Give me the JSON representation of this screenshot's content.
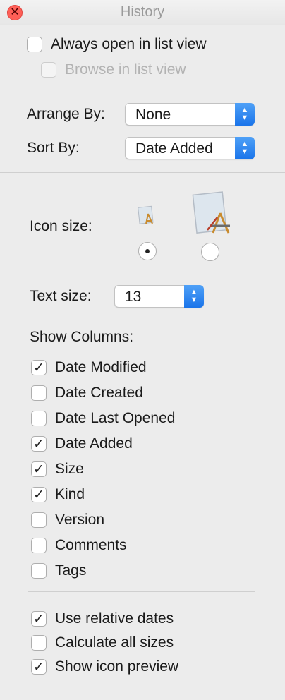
{
  "window": {
    "title": "History"
  },
  "icons": {
    "close": "close-icon",
    "app_small": "app-document-icon-small",
    "app_large": "app-document-icon-large"
  },
  "top_options": [
    {
      "label": "Always open in list view",
      "checked": false,
      "enabled": true
    },
    {
      "label": "Browse in list view",
      "checked": false,
      "enabled": false
    }
  ],
  "arrange": {
    "label": "Arrange By:",
    "value": "None"
  },
  "sort": {
    "label": "Sort By:",
    "value": "Date Added"
  },
  "icon_size": {
    "label": "Icon size:",
    "selected": "small"
  },
  "text_size": {
    "label": "Text size:",
    "value": "13"
  },
  "show_columns": {
    "label": "Show Columns:",
    "items": [
      {
        "label": "Date Modified",
        "checked": true
      },
      {
        "label": "Date Created",
        "checked": false
      },
      {
        "label": "Date Last Opened",
        "checked": false
      },
      {
        "label": "Date Added",
        "checked": true
      },
      {
        "label": "Size",
        "checked": true
      },
      {
        "label": "Kind",
        "checked": true
      },
      {
        "label": "Version",
        "checked": false
      },
      {
        "label": "Comments",
        "checked": false
      },
      {
        "label": "Tags",
        "checked": false
      }
    ]
  },
  "bottom_options": [
    {
      "label": "Use relative dates",
      "checked": true
    },
    {
      "label": "Calculate all sizes",
      "checked": false
    },
    {
      "label": "Show icon preview",
      "checked": true
    }
  ],
  "colors": {
    "accent": "#1a74ea",
    "close": "#ff5f57",
    "background": "#ececec"
  }
}
